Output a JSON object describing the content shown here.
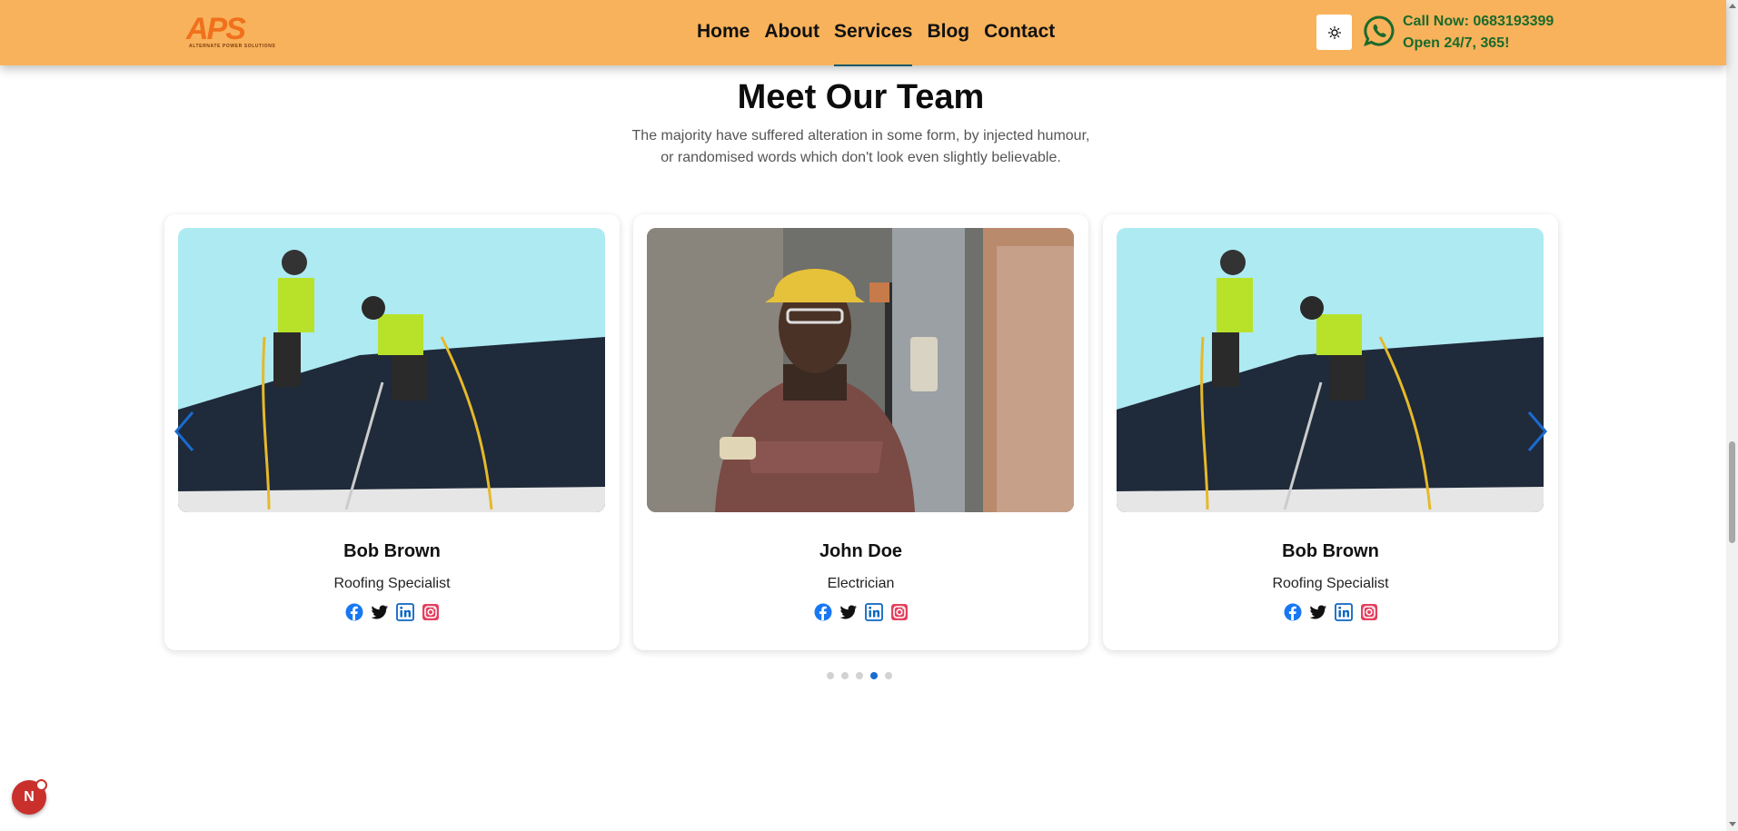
{
  "header": {
    "logo_text": "APS",
    "logo_subtext": "ALTERNATE POWER SOLUTIONS",
    "nav": [
      {
        "label": "Home",
        "active": false
      },
      {
        "label": "About",
        "active": false
      },
      {
        "label": "Services",
        "active": true
      },
      {
        "label": "Blog",
        "active": false
      },
      {
        "label": "Contact",
        "active": false
      }
    ],
    "theme_toggle_icon": "sun-icon",
    "contact_icon": "whatsapp-icon",
    "call_line": "Call Now: 0683193399",
    "hours_line": "Open 24/7, 365!"
  },
  "section": {
    "title": "Meet Our Team",
    "description": "The majority have suffered alteration in some form, by injected humour, or randomised words which don't look even slightly believable."
  },
  "team": [
    {
      "name": "Bob Brown",
      "role": "Roofing Specialist",
      "photo": "roofers-on-roof"
    },
    {
      "name": "John Doe",
      "role": "Electrician",
      "photo": "electrician-portrait"
    },
    {
      "name": "Bob Brown",
      "role": "Roofing Specialist",
      "photo": "roofers-on-roof"
    }
  ],
  "socials": [
    "facebook-icon",
    "twitter-icon",
    "linkedin-icon",
    "instagram-icon"
  ],
  "carousel": {
    "pages": 5,
    "active_page": 4,
    "prev_icon": "chevron-left-icon",
    "next_icon": "chevron-right-icon"
  },
  "floating_badge": {
    "letter": "N"
  },
  "colors": {
    "header_bg": "#f8b25b",
    "brand_orange": "#f0701c",
    "call_green": "#1b6a2b",
    "accent_blue": "#1a6bd1"
  }
}
